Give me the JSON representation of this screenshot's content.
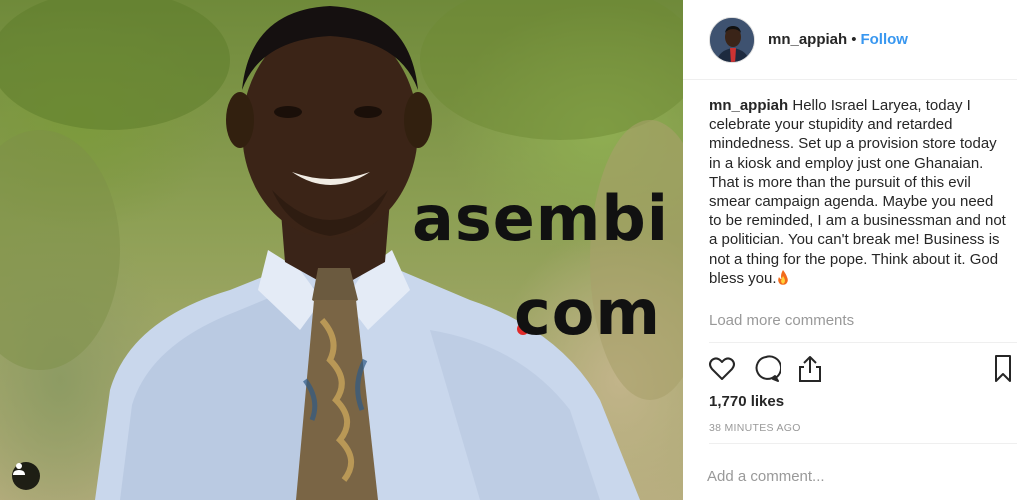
{
  "photo": {
    "watermark_line1": "asembi",
    "watermark_line2": "com",
    "watermark_dot_color": "#e02a2a",
    "user_tag_icon": "user-tag-icon"
  },
  "header": {
    "username": "mn_appiah",
    "separator": "•",
    "follow_label": "Follow",
    "accent_color": "#3897f0"
  },
  "caption": {
    "username": "mn_appiah",
    "text": "Hello Israel Laryea, today I celebrate your stupidity and retarded mindedness. Set up a provision store today in a kiosk and employ just one Ghanaian. That is more than the pursuit of this evil smear campaign agenda. Maybe you need to be reminded, I am a businessman and not a politician. You can't break me! Business is not a thing for the pope. Think about it. God bless you.",
    "trailing_icon": "fire-emoji-icon"
  },
  "comments": {
    "load_more_label": "Load more comments"
  },
  "actions": {
    "icons": [
      "heart-icon",
      "comment-icon",
      "share-icon",
      "bookmark-icon"
    ]
  },
  "stats": {
    "likes": "1,770 likes",
    "time": "38 MINUTES AGO"
  },
  "comment_box": {
    "placeholder": "Add a comment..."
  }
}
